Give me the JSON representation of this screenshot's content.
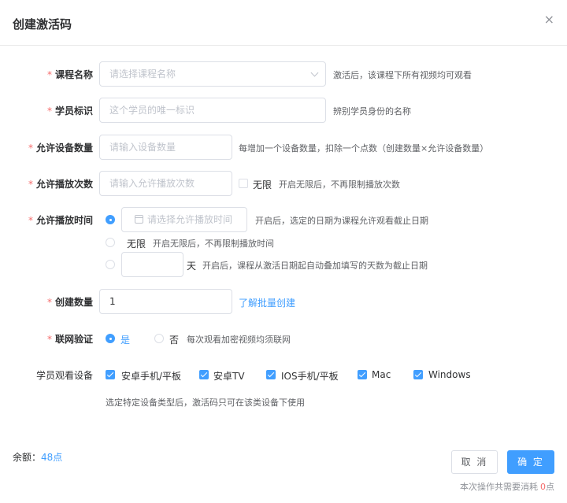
{
  "dialog": {
    "title": "创建激活码",
    "close_icon": "×"
  },
  "course": {
    "label": "课程名称",
    "placeholder": "请选择课程名称",
    "hint": "激活后，该课程下所有视频均可观看"
  },
  "student": {
    "label": "学员标识",
    "placeholder": "这个学员的唯一标识",
    "hint": "辨别学员身份的名称"
  },
  "devices": {
    "label": "允许设备数量",
    "placeholder": "请输入设备数量",
    "hint": "每增加一个设备数量，扣除一个点数（创建数量×允许设备数量）"
  },
  "plays": {
    "label": "允许播放次数",
    "placeholder": "请输入允许播放次数",
    "unlimited_label": "无限",
    "unlimited_checked": false,
    "hint": "开启无限后，不再限制播放次数"
  },
  "play_time": {
    "label": "允许播放时间",
    "options": [
      {
        "selected": true,
        "placeholder": "请选择允许播放时间",
        "hint": "开启后，选定的日期为课程允许观看截止日期"
      },
      {
        "selected": false,
        "label": "无限",
        "hint": "开启无限后，不再限制播放时间"
      },
      {
        "selected": false,
        "unit": "天",
        "value": "",
        "hint": "开启后，课程从激活日期起自动叠加填写的天数为截止日期"
      }
    ]
  },
  "quantity": {
    "label": "创建数量",
    "value": "1",
    "link": "了解批量创建"
  },
  "network": {
    "label": "联网验证",
    "yes": "是",
    "no": "否",
    "selected": "yes",
    "hint": "每次观看加密视频均须联网"
  },
  "watch_devices": {
    "label": "学员观看设备",
    "items": [
      {
        "label": "安卓手机/平板",
        "checked": true
      },
      {
        "label": "安卓TV",
        "checked": true
      },
      {
        "label": "IOS手机/平板",
        "checked": true
      },
      {
        "label": "Mac",
        "checked": true
      },
      {
        "label": "Windows",
        "checked": true
      }
    ],
    "hint": "选定特定设备类型后，激活码只可在该类设备下使用"
  },
  "footer": {
    "balance_label": "余额：",
    "balance_value": "48点",
    "cancel": "取 消",
    "confirm": "确 定",
    "cost_text": "本次操作共需要消耗",
    "cost_value": "0",
    "cost_unit": "点"
  },
  "colors": {
    "primary": "#409eff",
    "required": "#f56c6c",
    "text": "#606266",
    "placeholder": "#c0c4cc",
    "border": "#dcdfe6"
  }
}
